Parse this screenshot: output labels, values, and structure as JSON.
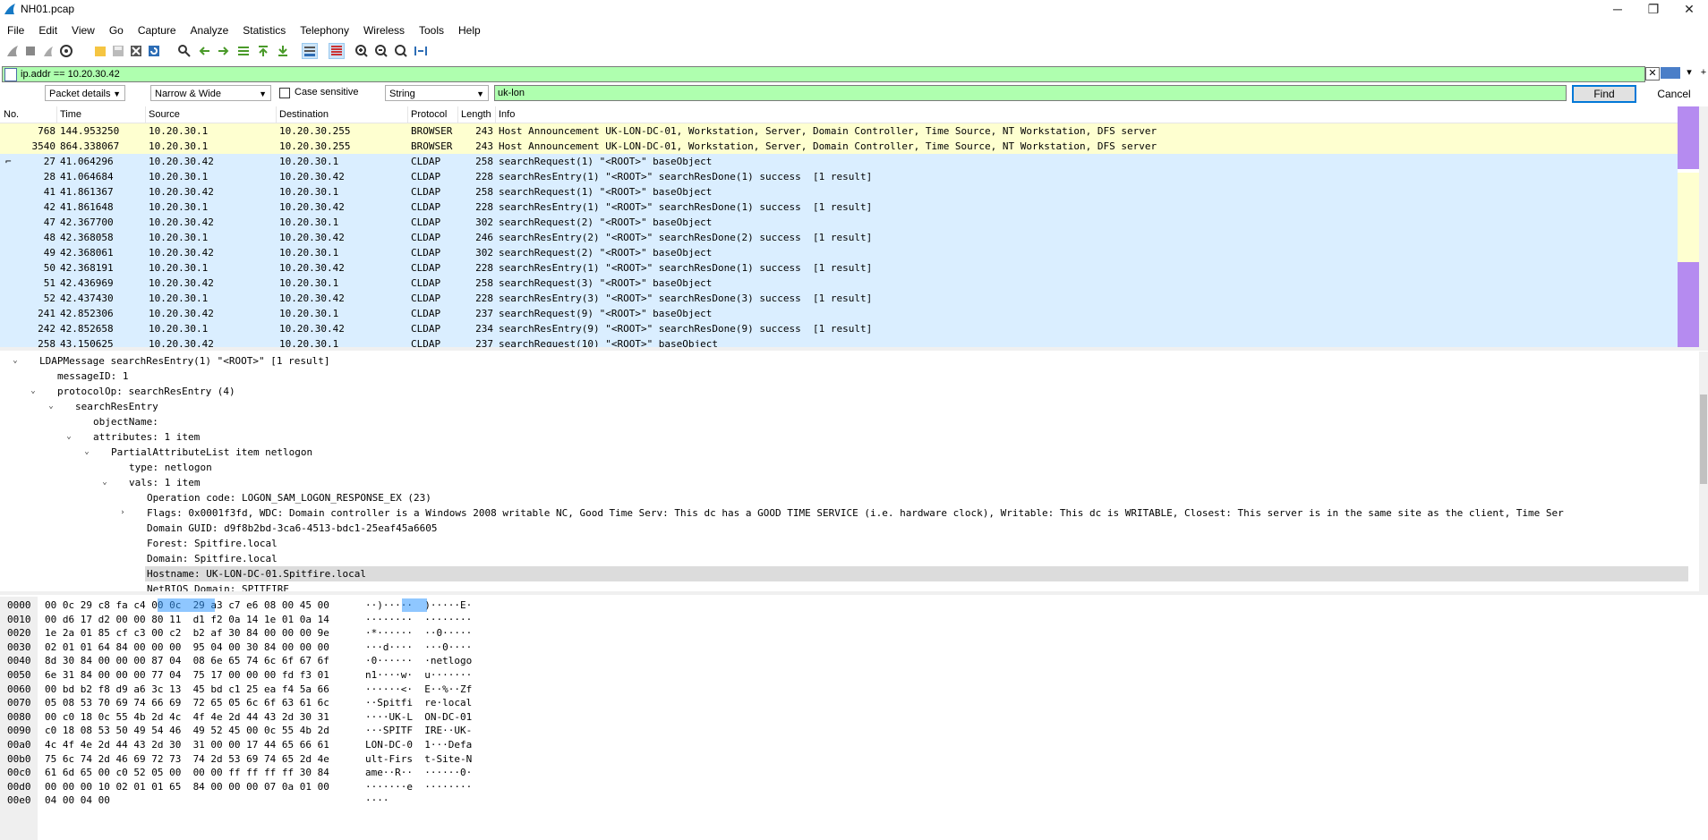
{
  "window": {
    "title": "NH01.pcap",
    "minimize": "─",
    "restore": "❐",
    "close": "✕"
  },
  "menu": [
    "File",
    "Edit",
    "View",
    "Go",
    "Capture",
    "Analyze",
    "Statistics",
    "Telephony",
    "Wireless",
    "Tools",
    "Help"
  ],
  "filter": {
    "value": "ip.addr == 10.20.30.42"
  },
  "find": {
    "scope": "Packet details",
    "char_width": "Narrow & Wide",
    "case_sensitive_label": "Case sensitive",
    "type": "String",
    "query": "uk-lon",
    "find_label": "Find",
    "cancel_label": "Cancel"
  },
  "packet_list": {
    "columns": [
      "No.",
      "Time",
      "Source",
      "Destination",
      "Protocol",
      "Length",
      "Info"
    ],
    "rows": [
      {
        "no": "768",
        "time": "144.953250",
        "src": "10.20.30.1",
        "dst": "10.20.30.255",
        "proto": "BROWSER",
        "len": "243",
        "info": "Host Announcement UK-LON-DC-01, Workstation, Server, Domain Controller, Time Source, NT Workstation, DFS server",
        "color": "y"
      },
      {
        "no": "3540",
        "time": "864.338067",
        "src": "10.20.30.1",
        "dst": "10.20.30.255",
        "proto": "BROWSER",
        "len": "243",
        "info": "Host Announcement UK-LON-DC-01, Workstation, Server, Domain Controller, Time Source, NT Workstation, DFS server",
        "color": "y"
      },
      {
        "no": "27",
        "time": "41.064296",
        "src": "10.20.30.42",
        "dst": "10.20.30.1",
        "proto": "CLDAP",
        "len": "258",
        "info": "searchRequest(1) \"<ROOT>\" baseObject",
        "color": "b"
      },
      {
        "no": "28",
        "time": "41.064684",
        "src": "10.20.30.1",
        "dst": "10.20.30.42",
        "proto": "CLDAP",
        "len": "228",
        "info": "searchResEntry(1) \"<ROOT>\" searchResDone(1) success  [1 result]",
        "color": "b"
      },
      {
        "no": "41",
        "time": "41.861367",
        "src": "10.20.30.42",
        "dst": "10.20.30.1",
        "proto": "CLDAP",
        "len": "258",
        "info": "searchRequest(1) \"<ROOT>\" baseObject",
        "color": "b"
      },
      {
        "no": "42",
        "time": "41.861648",
        "src": "10.20.30.1",
        "dst": "10.20.30.42",
        "proto": "CLDAP",
        "len": "228",
        "info": "searchResEntry(1) \"<ROOT>\" searchResDone(1) success  [1 result]",
        "color": "b"
      },
      {
        "no": "47",
        "time": "42.367700",
        "src": "10.20.30.42",
        "dst": "10.20.30.1",
        "proto": "CLDAP",
        "len": "302",
        "info": "searchRequest(2) \"<ROOT>\" baseObject",
        "color": "b"
      },
      {
        "no": "48",
        "time": "42.368058",
        "src": "10.20.30.1",
        "dst": "10.20.30.42",
        "proto": "CLDAP",
        "len": "246",
        "info": "searchResEntry(2) \"<ROOT>\" searchResDone(2) success  [1 result]",
        "color": "b"
      },
      {
        "no": "49",
        "time": "42.368061",
        "src": "10.20.30.42",
        "dst": "10.20.30.1",
        "proto": "CLDAP",
        "len": "302",
        "info": "searchRequest(2) \"<ROOT>\" baseObject",
        "color": "b"
      },
      {
        "no": "50",
        "time": "42.368191",
        "src": "10.20.30.1",
        "dst": "10.20.30.42",
        "proto": "CLDAP",
        "len": "228",
        "info": "searchResEntry(1) \"<ROOT>\" searchResDone(1) success  [1 result]",
        "color": "b"
      },
      {
        "no": "51",
        "time": "42.436969",
        "src": "10.20.30.42",
        "dst": "10.20.30.1",
        "proto": "CLDAP",
        "len": "258",
        "info": "searchRequest(3) \"<ROOT>\" baseObject",
        "color": "b"
      },
      {
        "no": "52",
        "time": "42.437430",
        "src": "10.20.30.1",
        "dst": "10.20.30.42",
        "proto": "CLDAP",
        "len": "228",
        "info": "searchResEntry(3) \"<ROOT>\" searchResDone(3) success  [1 result]",
        "color": "b"
      },
      {
        "no": "241",
        "time": "42.852306",
        "src": "10.20.30.42",
        "dst": "10.20.30.1",
        "proto": "CLDAP",
        "len": "237",
        "info": "searchRequest(9) \"<ROOT>\" baseObject",
        "color": "b"
      },
      {
        "no": "242",
        "time": "42.852658",
        "src": "10.20.30.1",
        "dst": "10.20.30.42",
        "proto": "CLDAP",
        "len": "234",
        "info": "searchResEntry(9) \"<ROOT>\" searchResDone(9) success  [1 result]",
        "color": "b"
      },
      {
        "no": "258",
        "time": "43.150625",
        "src": "10.20.30.42",
        "dst": "10.20.30.1",
        "proto": "CLDAP",
        "len": "237",
        "info": "searchRequest(10) \"<ROOT>\" baseObject",
        "color": "b"
      }
    ]
  },
  "details": {
    "lines": [
      {
        "indent": 0,
        "arrow": "open",
        "text": "LDAPMessage searchResEntry(1) \"<ROOT>\" [1 result]"
      },
      {
        "indent": 1,
        "arrow": "",
        "text": "messageID: 1"
      },
      {
        "indent": 1,
        "arrow": "open",
        "text": "protocolOp: searchResEntry (4)"
      },
      {
        "indent": 2,
        "arrow": "open",
        "text": "searchResEntry"
      },
      {
        "indent": 3,
        "arrow": "",
        "text": "objectName:"
      },
      {
        "indent": 3,
        "arrow": "open",
        "text": "attributes: 1 item"
      },
      {
        "indent": 4,
        "arrow": "open",
        "text": "PartialAttributeList item netlogon"
      },
      {
        "indent": 5,
        "arrow": "",
        "text": "type: netlogon"
      },
      {
        "indent": 5,
        "arrow": "open",
        "text": "vals: 1 item"
      },
      {
        "indent": 6,
        "arrow": "",
        "text": "Operation code: LOGON_SAM_LOGON_RESPONSE_EX (23)"
      },
      {
        "indent": 6,
        "arrow": "closed",
        "text": "Flags: 0x0001f3fd, WDC: Domain controller is a Windows 2008 writable NC, Good Time Serv: This dc has a GOOD TIME SERVICE (i.e. hardware clock), Writable: This dc is WRITABLE, Closest: This server is in the same site as the client, Time Ser"
      },
      {
        "indent": 6,
        "arrow": "",
        "text": "Domain GUID: d9f8b2bd-3ca6-4513-bdc1-25eaf45a6605"
      },
      {
        "indent": 6,
        "arrow": "",
        "text": "Forest: Spitfire.local"
      },
      {
        "indent": 6,
        "arrow": "",
        "text": "Domain: Spitfire.local"
      },
      {
        "indent": 6,
        "arrow": "",
        "text": "Hostname: UK-LON-DC-01.Spitfire.local",
        "highlight": true
      },
      {
        "indent": 6,
        "arrow": "",
        "text": "NetBIOS Domain: SPITFIRE"
      }
    ]
  },
  "bytes": {
    "rows": [
      {
        "off": "0000",
        "hex": "00 0c 29 c8 fa c4 00 0c  29 a3 c7 e6 08 00 45 00",
        "ascii": "··)·····  )·····E·"
      },
      {
        "off": "0010",
        "hex": "00 d6 17 d2 00 00 80 11  d1 f2 0a 14 1e 01 0a 14",
        "ascii": "········  ········"
      },
      {
        "off": "0020",
        "hex": "1e 2a 01 85 cf c3 00 c2  b2 af 30 84 00 00 00 9e",
        "ascii": "·*······  ··0·····"
      },
      {
        "off": "0030",
        "hex": "02 01 01 64 84 00 00 00  95 04 00 30 84 00 00 00",
        "ascii": "···d····  ···0····"
      },
      {
        "off": "0040",
        "hex": "8d 30 84 00 00 00 87 04  08 6e 65 74 6c 6f 67 6f",
        "ascii": "·0······  ·netlogo"
      },
      {
        "off": "0050",
        "hex": "6e 31 84 00 00 00 77 04  75 17 00 00 00 fd f3 01",
        "ascii": "n1····w·  u·······"
      },
      {
        "off": "0060",
        "hex": "00 bd b2 f8 d9 a6 3c 13  45 bd c1 25 ea f4 5a 66",
        "ascii": "······<·  E··%··Zf"
      },
      {
        "off": "0070",
        "hex": "05 08 53 70 69 74 66 69  72 65 05 6c 6f 63 61 6c",
        "ascii": "··Spitfi  re·local"
      },
      {
        "off": "0080",
        "hex": "00 c0 18 0c 55 4b 2d 4c  4f 4e 2d 44 43 2d 30 31",
        "ascii": "····UK-L  ON-DC-01"
      },
      {
        "off": "0090",
        "hex": "c0 18 08 53 50 49 54 46  49 52 45 00 0c 55 4b 2d",
        "ascii": "···SPITF  IRE··UK-"
      },
      {
        "off": "00a0",
        "hex": "4c 4f 4e 2d 44 43 2d 30  31 00 00 17 44 65 66 61",
        "ascii": "LON-DC-0  1···Defa"
      },
      {
        "off": "00b0",
        "hex": "75 6c 74 2d 46 69 72 73  74 2d 53 69 74 65 2d 4e",
        "ascii": "ult-Firs  t-Site-N"
      },
      {
        "off": "00c0",
        "hex": "61 6d 65 00 c0 52 05 00  00 00 ff ff ff ff 30 84",
        "ascii": "ame··R··  ······0·"
      },
      {
        "off": "00d0",
        "hex": "00 00 00 10 02 01 01 65  84 00 00 00 07 0a 01 00",
        "ascii": "·······e  ········"
      },
      {
        "off": "00e0",
        "hex": "04 00 04 00",
        "ascii": "····"
      }
    ]
  },
  "colors": {
    "filter_bg": "#afffaf",
    "row_yellow": "#feffd0",
    "row_blue": "#daeeff",
    "selected_bytes": "#3399ff"
  }
}
